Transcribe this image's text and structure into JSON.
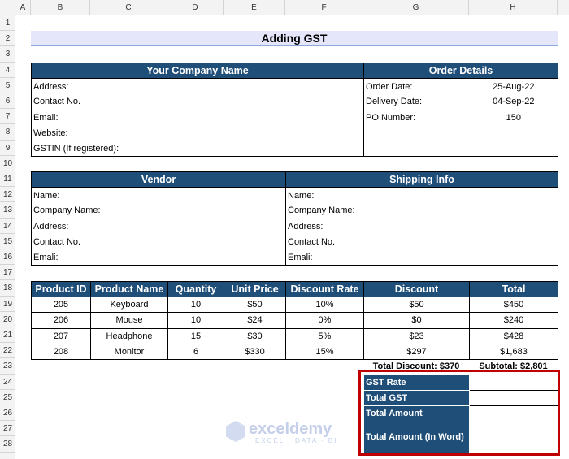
{
  "columns": [
    "A",
    "B",
    "C",
    "D",
    "E",
    "F",
    "G",
    "H"
  ],
  "rows": [
    "1",
    "2",
    "3",
    "4",
    "5",
    "6",
    "7",
    "8",
    "9",
    "10",
    "11",
    "12",
    "13",
    "14",
    "15",
    "16",
    "17",
    "18",
    "19",
    "20",
    "21",
    "22",
    "23",
    "24",
    "25",
    "26",
    "27",
    "28"
  ],
  "title": "Adding GST",
  "company": {
    "header": "Your Company Name",
    "fields": [
      "Address:",
      "Contact No.",
      "Emali:",
      "Website:",
      "GSTIN (If registered):"
    ]
  },
  "order": {
    "header": "Order Details",
    "fields": [
      {
        "label": "Order Date:",
        "value": "25-Aug-22"
      },
      {
        "label": "Delivery Date:",
        "value": "04-Sep-22"
      },
      {
        "label": "PO Number:",
        "value": "150"
      }
    ]
  },
  "vendor": {
    "header": "Vendor",
    "fields": [
      "Name:",
      "Company Name:",
      "Address:",
      "Contact No.",
      "Emali:"
    ]
  },
  "shipping": {
    "header": "Shipping Info",
    "fields": [
      "Name:",
      "Company Name:",
      "Address:",
      "Contact No.",
      "Emali:"
    ]
  },
  "products": {
    "headers": [
      "Product ID",
      "Product Name",
      "Quantity",
      "Unit Price",
      "Discount Rate",
      "Discount",
      "Total"
    ],
    "rows": [
      [
        "205",
        "Keyboard",
        "10",
        "$50",
        "10%",
        "$50",
        "$450"
      ],
      [
        "206",
        "Mouse",
        "10",
        "$24",
        "0%",
        "$0",
        "$240"
      ],
      [
        "207",
        "Headphone",
        "15",
        "$30",
        "5%",
        "$23",
        "$428"
      ],
      [
        "208",
        "Monitor",
        "6",
        "$330",
        "15%",
        "$297",
        "$1,683"
      ]
    ],
    "total_discount": "Total Discount: $370",
    "subtotal": "Subtotal: $2,801"
  },
  "gst": {
    "labels": [
      "GST Rate",
      "Total GST",
      "Total Amount",
      "Total Amount (In Word)"
    ]
  },
  "watermark": {
    "name": "exceldemy",
    "tagline": "EXCEL · DATA · BI"
  },
  "colors": {
    "header": "#1f4e79",
    "highlight": "#c00000",
    "title_bg": "#e6e6fa"
  }
}
